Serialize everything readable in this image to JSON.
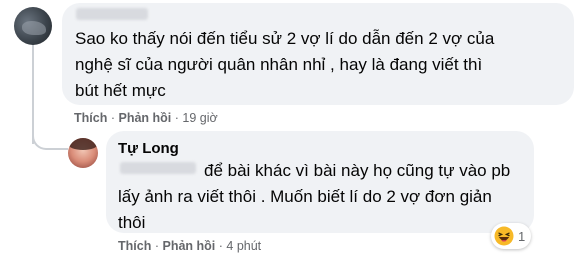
{
  "comments": [
    {
      "text": "Sao ko thấy nói đến tiểu sử 2 vợ lí do dẫn đến 2 vợ của\nnghệ sĩ của người quân nhân nhỉ , hay là đang viết thì\nbút hết mực",
      "actions": {
        "like": "Thích",
        "reply": "Phản hồi",
        "time": "19 giờ"
      }
    },
    {
      "author": "Tự Long",
      "text": "để bài khác vì bài này họ cũng tự vào pb\nlấy ảnh ra viết thôi . Muốn biết lí do 2 vợ đơn giản\nthôi",
      "actions": {
        "like": "Thích",
        "reply": "Phản hồi",
        "time": "4 phút"
      },
      "reaction": {
        "icon": "haha-emoji-icon",
        "count": "1"
      }
    }
  ],
  "separator": "·"
}
